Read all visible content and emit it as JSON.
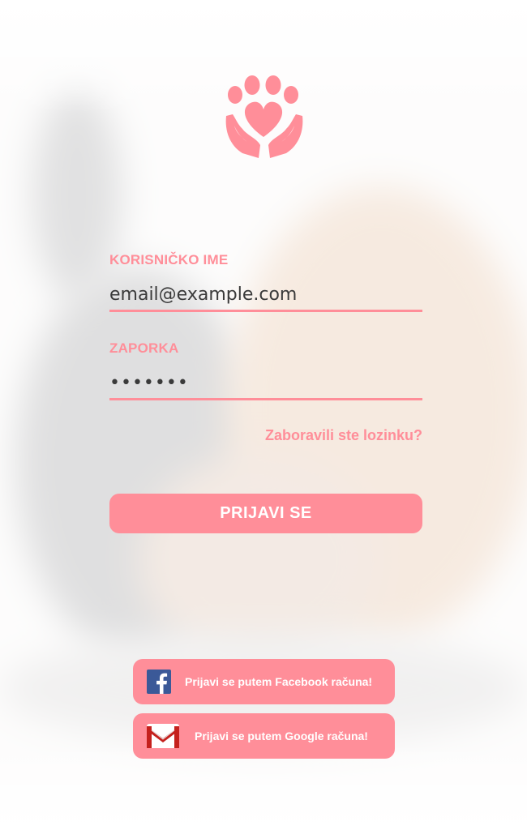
{
  "app": {
    "logo_icon": "paw-heart-hands-icon",
    "accent_color": "#ff8e99"
  },
  "form": {
    "username_label": "KORISNIČKO IME",
    "username_value": "email@example.com",
    "password_label": "ZAPORKA",
    "password_value": "•••••••",
    "forgot_password": "Zaboravili ste lozinku?",
    "login_button": "PRIJAVI SE"
  },
  "social": {
    "facebook_label": "Prijavi se putem Facebook računa!",
    "facebook_icon": "facebook-icon",
    "google_label": "Prijavi se putem Google računa!",
    "google_icon": "gmail-icon"
  }
}
